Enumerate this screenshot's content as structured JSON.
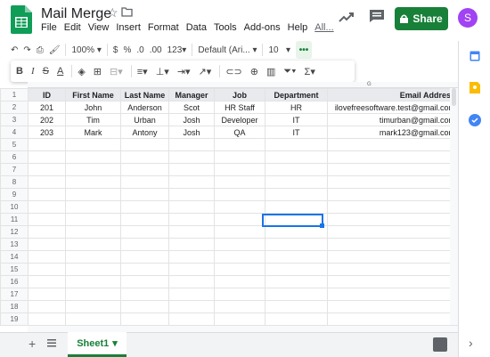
{
  "doc": {
    "title": "Mail Merge"
  },
  "menu": [
    "File",
    "Edit",
    "View",
    "Insert",
    "Format",
    "Data",
    "Tools",
    "Add-ons",
    "Help",
    "All..."
  ],
  "share": {
    "label": "Share"
  },
  "user": {
    "initial": "S"
  },
  "toolbar": {
    "zoom": "100%",
    "currency": "$",
    "percent": "%",
    "dec_less": ".0",
    "dec_more": ".00",
    "format_more": "123",
    "font": "Default (Ari...",
    "font_size": "10",
    "more": "•••"
  },
  "toolbar2": {
    "bold": "B",
    "italic": "I",
    "strike": "S",
    "textcolor": "A"
  },
  "grid": {
    "col_g_letter": "G",
    "headers": [
      "ID",
      "First Name",
      "Last Name",
      "Manager",
      "Job",
      "Department",
      "Email Address"
    ],
    "rows": [
      [
        "201",
        "John",
        "Anderson",
        "Scot",
        "HR Staff",
        "HR",
        "ilovefreesoftware.test@gmail.com"
      ],
      [
        "202",
        "Tim",
        "Urban",
        "Josh",
        "Developer",
        "IT",
        "timurban@gmail.com"
      ],
      [
        "203",
        "Mark",
        "Antony",
        "Josh",
        "QA",
        "IT",
        "mark123@gmail.com"
      ]
    ],
    "row_numbers": [
      "1",
      "2",
      "3",
      "4",
      "5",
      "6",
      "7",
      "8",
      "9",
      "10",
      "11",
      "12",
      "13",
      "14",
      "15",
      "16",
      "17",
      "18",
      "19"
    ]
  },
  "sheet_tab": {
    "label": "Sheet1"
  },
  "colors": {
    "green": "#188038",
    "blue": "#1a73e8",
    "avatar": "#a142f4"
  }
}
